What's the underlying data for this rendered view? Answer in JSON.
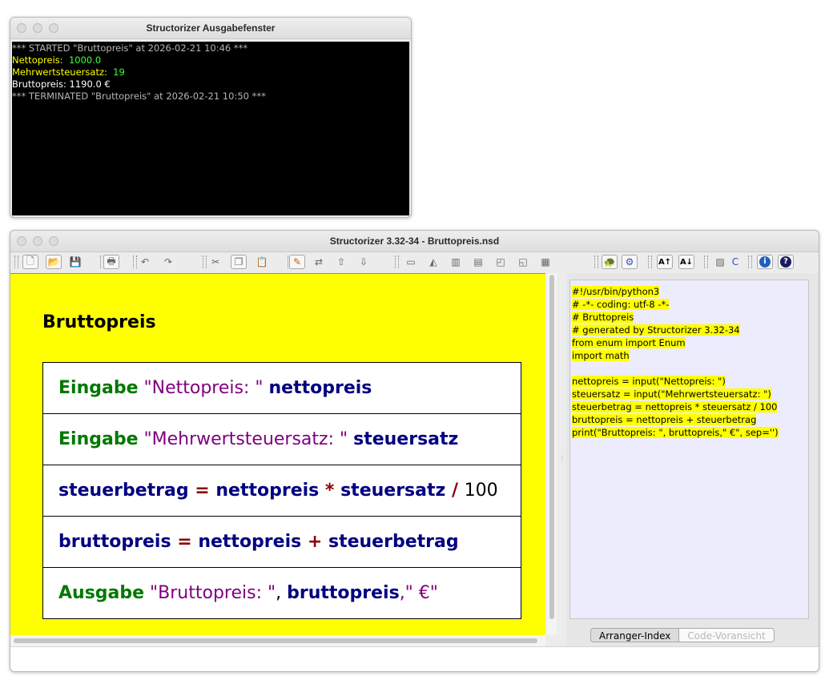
{
  "output_window": {
    "title": "Structorizer Ausgabefenster",
    "lines": [
      {
        "text": "*** STARTED \"Bruttopreis\" at 2026-02-21 10:46 ***",
        "color": "#b4b4b4"
      },
      {
        "text": "Nettopreis: ",
        "color": "#ffff00",
        "value": " 1000.0",
        "value_color": "#3cff3c"
      },
      {
        "text": "Mehrwertsteuersatz: ",
        "color": "#ffff00",
        "value": " 19",
        "value_color": "#3cff3c"
      },
      {
        "text": "Bruttopreis: 1190.0 €",
        "color": "#ffffff"
      },
      {
        "text": "*** TERMINATED \"Bruttopreis\" at 2026-02-21 10:50 ***",
        "color": "#b4b4b4"
      }
    ]
  },
  "main_window": {
    "title": "Structorizer 3.32-34 - Bruttopreis.nsd",
    "toolbar_icons": [
      "new-file-icon",
      "open-folder-icon",
      "save-icon",
      "print-icon",
      "undo-icon",
      "redo-icon",
      "cut-icon",
      "copy-icon",
      "paste-icon",
      "edit-element-icon",
      "transmute-icon",
      "move-up-icon",
      "move-down-icon",
      "add-instruction-icon",
      "add-alternative-icon",
      "add-case-icon",
      "add-for-loop-icon",
      "add-while-loop-icon",
      "add-repeat-loop-icon",
      "add-call-icon",
      "run-turtle-icon",
      "executor-icon",
      "font-up-icon",
      "font-down-icon",
      "export-icon",
      "analyser-icon",
      "about-icon",
      "help-icon"
    ],
    "diagram": {
      "title": "Bruttopreis",
      "statements": [
        {
          "name": "stmt-input-nettopreis",
          "parts": [
            {
              "t": "Eingabe",
              "c": "kw"
            },
            {
              "t": " \"Nettopreis: \" ",
              "c": "str"
            },
            {
              "t": "nettopreis",
              "c": "var"
            }
          ]
        },
        {
          "name": "stmt-input-steuersatz",
          "parts": [
            {
              "t": "Eingabe",
              "c": "kw"
            },
            {
              "t": " \"Mehrwertsteuersatz: \" ",
              "c": "str"
            },
            {
              "t": "steuersatz",
              "c": "var"
            }
          ]
        },
        {
          "name": "stmt-assign-steuerbetrag",
          "parts": [
            {
              "t": "steuerbetrag",
              "c": "var"
            },
            {
              "t": " = ",
              "c": "op"
            },
            {
              "t": "nettopreis",
              "c": "var"
            },
            {
              "t": " * ",
              "c": "op"
            },
            {
              "t": "steuersatz",
              "c": "var"
            },
            {
              "t": " / ",
              "c": "op"
            },
            {
              "t": "100",
              "c": "num"
            }
          ]
        },
        {
          "name": "stmt-assign-bruttopreis",
          "parts": [
            {
              "t": "bruttopreis",
              "c": "var"
            },
            {
              "t": " = ",
              "c": "op"
            },
            {
              "t": "nettopreis",
              "c": "var"
            },
            {
              "t": " + ",
              "c": "op"
            },
            {
              "t": "steuerbetrag",
              "c": "var"
            }
          ]
        },
        {
          "name": "stmt-output-bruttopreis",
          "parts": [
            {
              "t": "Ausgabe",
              "c": "kw"
            },
            {
              "t": " \"Bruttopreis: \"",
              "c": "str"
            },
            {
              "t": ", ",
              "c": "num"
            },
            {
              "t": "bruttopreis",
              "c": "var"
            },
            {
              "t": ",\" €\"",
              "c": "str"
            }
          ]
        }
      ]
    },
    "code_preview": [
      "#!/usr/bin/python3",
      "# -*- coding: utf-8 -*-",
      "# Bruttopreis",
      "# generated by Structorizer 3.32-34",
      "from enum import Enum",
      "import math",
      "",
      "nettopreis = input(\"Nettopreis: \")",
      "steuersatz = input(\"Mehrwertsteuersatz: \")",
      "steuerbetrag = nettopreis * steuersatz / 100",
      "bruttopreis = nettopreis + steuerbetrag",
      "print(\"Bruttopreis: \", bruttopreis,\" €\", sep='')"
    ],
    "tabs": {
      "arranger": "Arranger-Index",
      "code": "Code-Voransicht"
    },
    "colors": {
      "canvas": "#ffff00",
      "keyword": "#007800",
      "string": "#800080",
      "variable": "#000080",
      "operator": "#8b0000"
    }
  }
}
